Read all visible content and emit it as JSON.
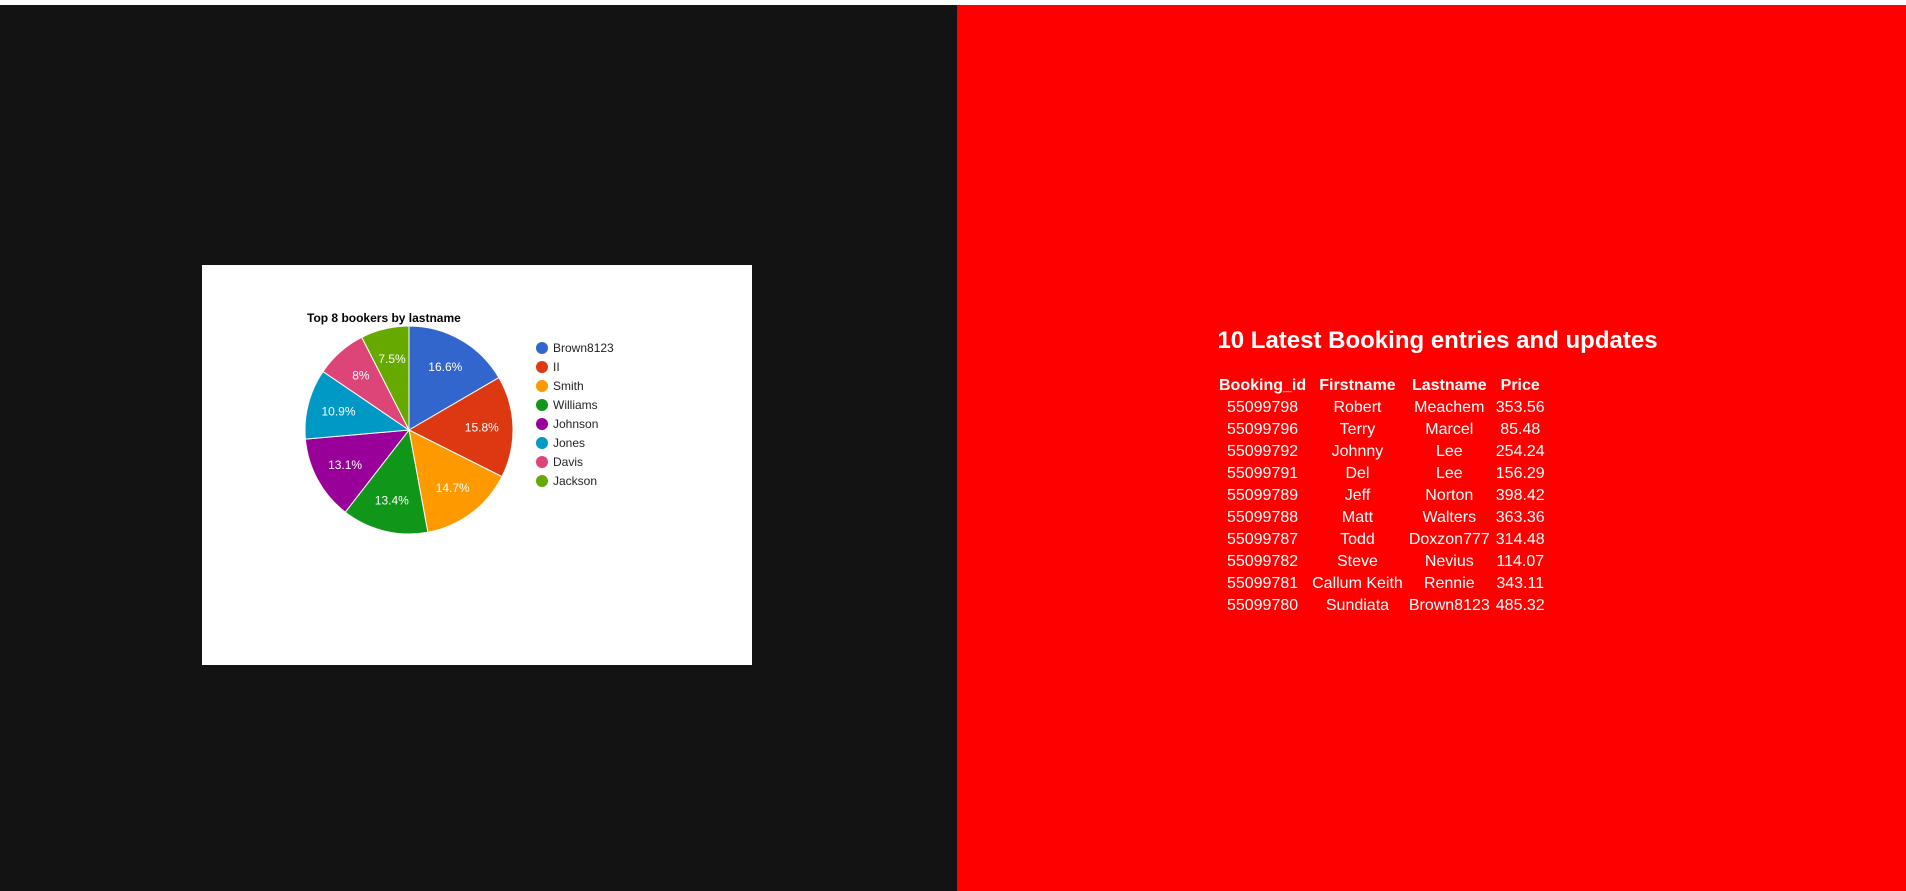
{
  "colors": {
    "left_bg": "#131313",
    "right_bg": "#ff0000"
  },
  "chart_data": {
    "type": "pie",
    "title": "Top 8 bookers by lastname",
    "legend_position": "right",
    "slices": [
      {
        "label": "Brown8123",
        "percent": 16.6,
        "display": "16.6%",
        "color": "#3366cc"
      },
      {
        "label": "II",
        "percent": 15.8,
        "display": "15.8%",
        "color": "#dc3912"
      },
      {
        "label": "Smith",
        "percent": 14.7,
        "display": "14.7%",
        "color": "#ff9900"
      },
      {
        "label": "Williams",
        "percent": 13.4,
        "display": "13.4%",
        "color": "#109618"
      },
      {
        "label": "Johnson",
        "percent": 13.1,
        "display": "13.1%",
        "color": "#990099"
      },
      {
        "label": "Jones",
        "percent": 10.9,
        "display": "10.9%",
        "color": "#0099c6"
      },
      {
        "label": "Davis",
        "percent": 8.0,
        "display": "8%",
        "color": "#dd4477"
      },
      {
        "label": "Jackson",
        "percent": 7.5,
        "display": "7.5%",
        "color": "#66aa00"
      }
    ]
  },
  "bookings": {
    "heading": "10 Latest Booking entries and updates",
    "columns": [
      "Booking_id",
      "Firstname",
      "Lastname",
      "Price"
    ],
    "rows": [
      [
        "55099798",
        "Robert",
        "Meachem",
        "353.56"
      ],
      [
        "55099796",
        "Terry",
        "Marcel",
        "85.48"
      ],
      [
        "55099792",
        "Johnny",
        "Lee",
        "254.24"
      ],
      [
        "55099791",
        "Del",
        "Lee",
        "156.29"
      ],
      [
        "55099789",
        "Jeff",
        "Norton",
        "398.42"
      ],
      [
        "55099788",
        "Matt",
        "Walters",
        "363.36"
      ],
      [
        "55099787",
        "Todd",
        "Doxzon777",
        "314.48"
      ],
      [
        "55099782",
        "Steve",
        "Nevius",
        "114.07"
      ],
      [
        "55099781",
        "Callum Keith",
        "Rennie",
        "343.11"
      ],
      [
        "55099780",
        "Sundiata",
        "Brown8123",
        "485.32"
      ]
    ]
  }
}
